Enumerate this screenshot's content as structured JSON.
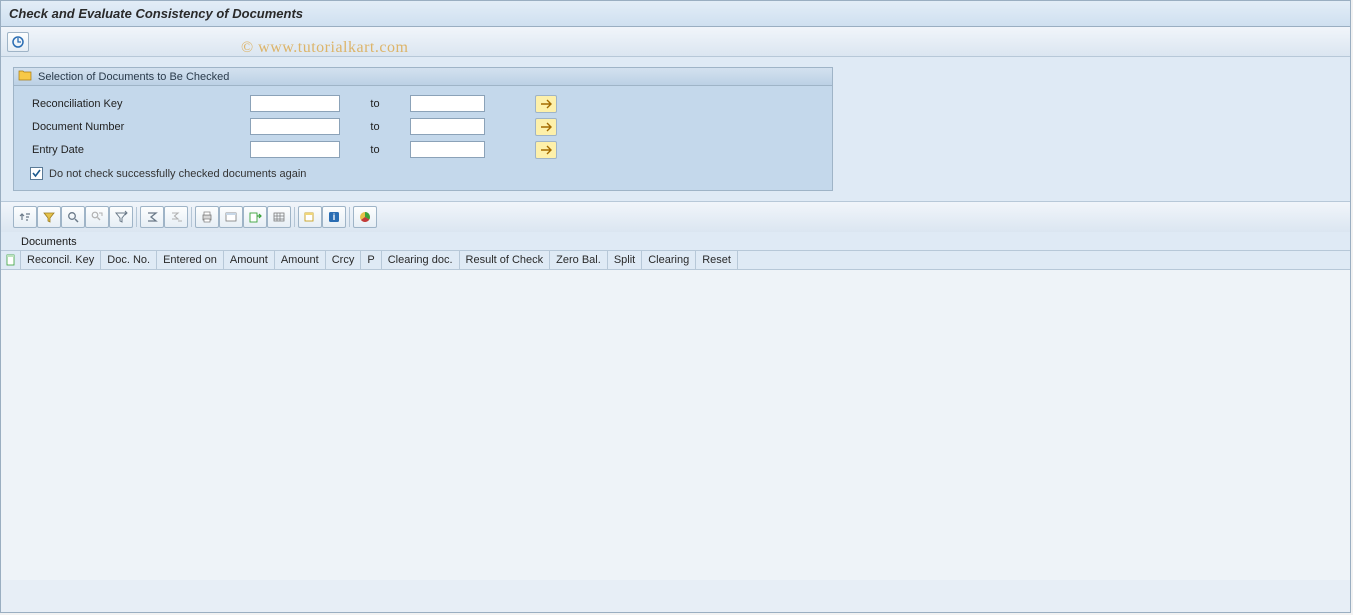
{
  "header": {
    "title": "Check and Evaluate Consistency of Documents"
  },
  "selection_box": {
    "title": "Selection of Documents to Be Checked",
    "fields": [
      {
        "label": "Reconciliation Key",
        "from": "",
        "to_label": "to",
        "to": ""
      },
      {
        "label": "Document Number",
        "from": "",
        "to_label": "to",
        "to": ""
      },
      {
        "label": "Entry Date",
        "from": "",
        "to_label": "to",
        "to": ""
      }
    ],
    "checkbox": {
      "checked": true,
      "label": "Do not check successfully checked documents again"
    }
  },
  "alv": {
    "heading": "Documents",
    "columns": [
      "Reconcil. Key",
      "Doc. No.",
      "Entered on",
      "Amount",
      "Amount",
      "Crcy",
      "P",
      "Clearing doc.",
      "Result of Check",
      "Zero Bal.",
      "Split",
      "Clearing",
      "Reset"
    ]
  },
  "watermark": "© www.tutorialkart.com"
}
